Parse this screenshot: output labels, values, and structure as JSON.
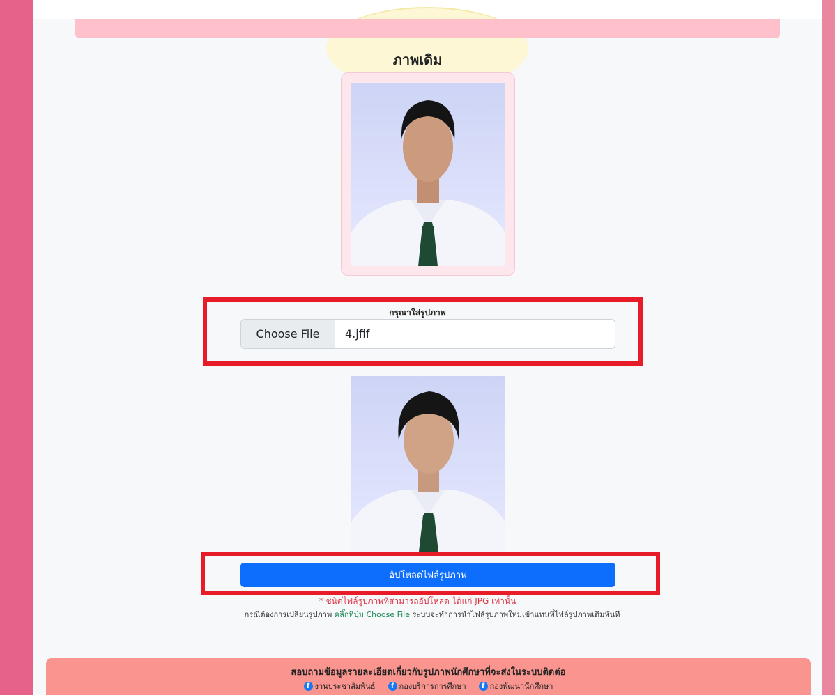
{
  "original_photo": {
    "title": "ภาพเดิม"
  },
  "upload": {
    "label": "กรุณาใส่รูปภาพ",
    "button_label": "Choose File",
    "file_name": "4.jfif"
  },
  "submit": {
    "label": "อัปโหลดไฟล์รูปภาพ"
  },
  "notes": {
    "file_type": "* ชนิดไฟล์รูปภาพที่สามารถอัปโหลด ได้แก่ JPG เท่านั้น",
    "replace_prefix": "กรณีต้องการเปลี่ยนรูปภาพ",
    "replace_link": "คลิ๊กที่ปุ่ม Choose File",
    "replace_suffix": "ระบบจะทำการนำไฟล์รูปภาพใหม่เข้าแทนที่ไฟล์รูปภาพเดิมทันที"
  },
  "footer": {
    "title": "สอบถามข้อมูลรายละเอียดเกี่ยวกับรูปภาพนักศึกษาที่จะส่งในระบบติดต่อ",
    "links": [
      {
        "label": "งานประชาสัมพันธ์",
        "icon": "facebook-icon"
      },
      {
        "label": "กองบริการการศึกษา",
        "icon": "facebook-icon"
      },
      {
        "label": "กองพัฒนานักศึกษา",
        "icon": "facebook-icon"
      }
    ]
  },
  "colors": {
    "primary_button": "#0d6efd",
    "highlight_box": "#e81c28",
    "warning_text": "#dc3545",
    "link_text": "#198754",
    "footer_bg": "#f9958e",
    "side_left": "#e6628a"
  }
}
